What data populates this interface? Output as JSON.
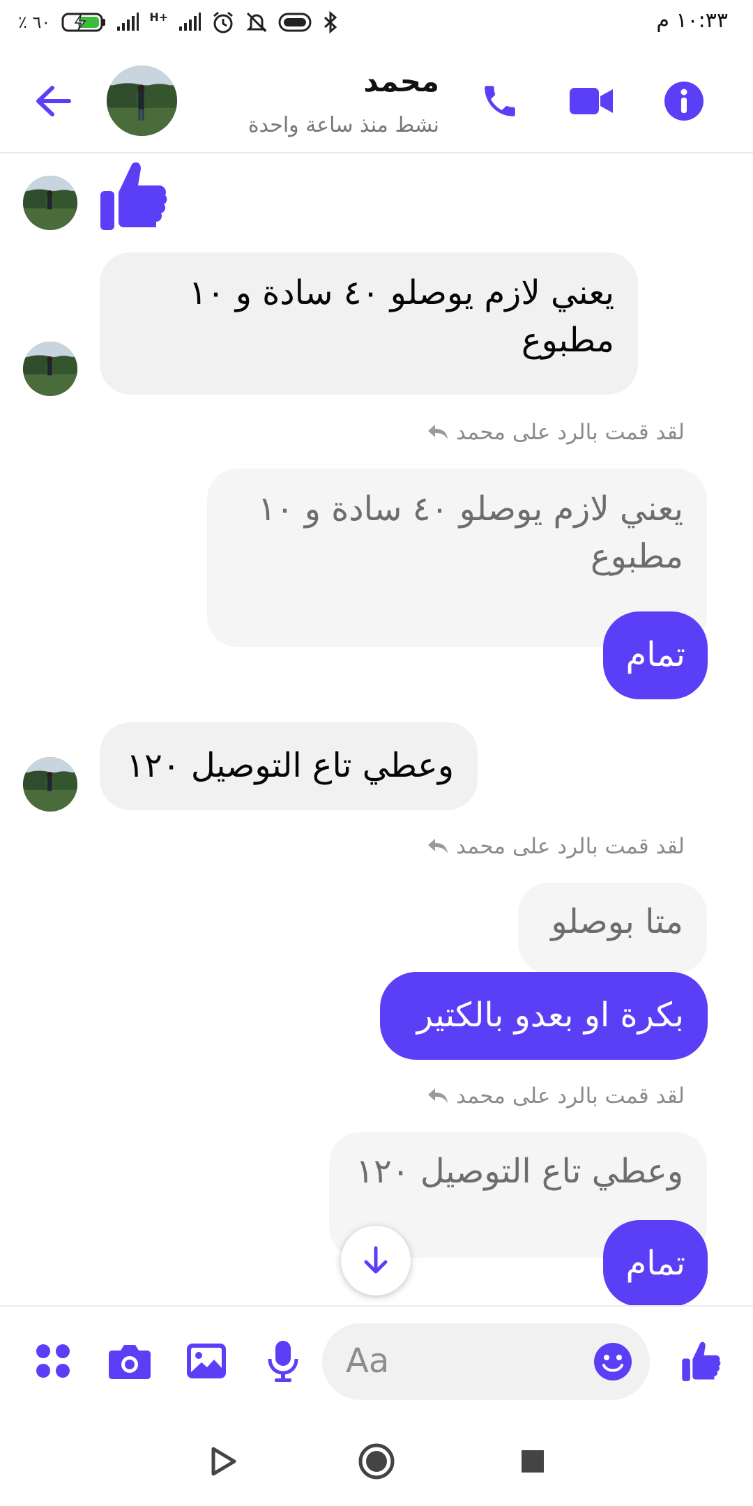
{
  "status_bar": {
    "time": "١٠:٣٣ م",
    "battery_percent": "٦٠ ٪",
    "network_type": "H+"
  },
  "header": {
    "contact_name": "محمد",
    "contact_status": "نشط منذ ساعة واحدة"
  },
  "messages": {
    "m1_text": "يعني لازم يوصلو ٤٠ سادة و ١٠ مطبوع",
    "reply1_note": "لقد قمت بالرد على محمد",
    "reply1_quote": "يعني لازم يوصلو ٤٠ سادة و ١٠ مطبوع",
    "reply1_text": "تمام",
    "m2_text": "وعطي تاع التوصيل ١٢٠",
    "reply2_note": "لقد قمت بالرد على محمد",
    "reply2_quote": "متا بوصلو",
    "reply2_text": "بكرة او بعدو بالكتير",
    "reply3_note": "لقد قمت بالرد على محمد",
    "reply3_quote": "وعطي تاع التوصيل ١٢٠",
    "reply3_text": "تمام"
  },
  "composer": {
    "placeholder": "Aa"
  },
  "colors": {
    "accent": "#5b3ff7",
    "incoming_bubble": "#f1f1f2",
    "quoted_bubble": "#f5f5f6",
    "muted_text": "#8a8a8a"
  },
  "icons": {
    "back": "arrow-left-icon",
    "call": "phone-icon",
    "video": "video-camera-icon",
    "info": "info-icon",
    "like": "thumbs-up-icon",
    "reply": "reply-arrow-icon",
    "scroll_down": "arrow-down-icon",
    "more": "four-dots-icon",
    "camera": "camera-icon",
    "gallery": "image-icon",
    "mic": "microphone-icon",
    "emoji": "smiley-icon"
  }
}
